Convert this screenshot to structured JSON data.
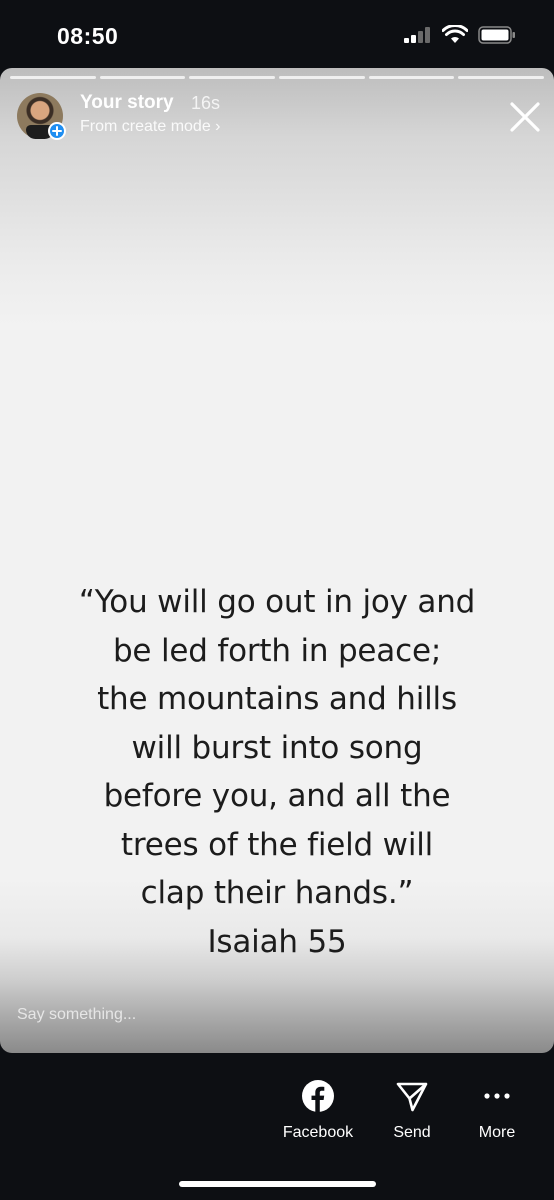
{
  "status": {
    "time": "08:50"
  },
  "story": {
    "owner": "Your story",
    "age": "16s",
    "subtitle": "From create mode ›",
    "segments": 6,
    "quote_lines": [
      "“You will go out in joy and",
      "be led forth in peace;",
      "the mountains and hills",
      "will burst into song",
      "before you, and all the",
      "trees of the field will",
      "clap their hands.”",
      "Isaiah 55"
    ],
    "reply_placeholder": "Say something..."
  },
  "actions": [
    {
      "label": "Facebook",
      "icon": "facebook-icon"
    },
    {
      "label": "Send",
      "icon": "send-icon"
    },
    {
      "label": "More",
      "icon": "more-icon"
    }
  ],
  "colors": {
    "badge": "#1f8ef1",
    "background": "#0d0f13"
  }
}
